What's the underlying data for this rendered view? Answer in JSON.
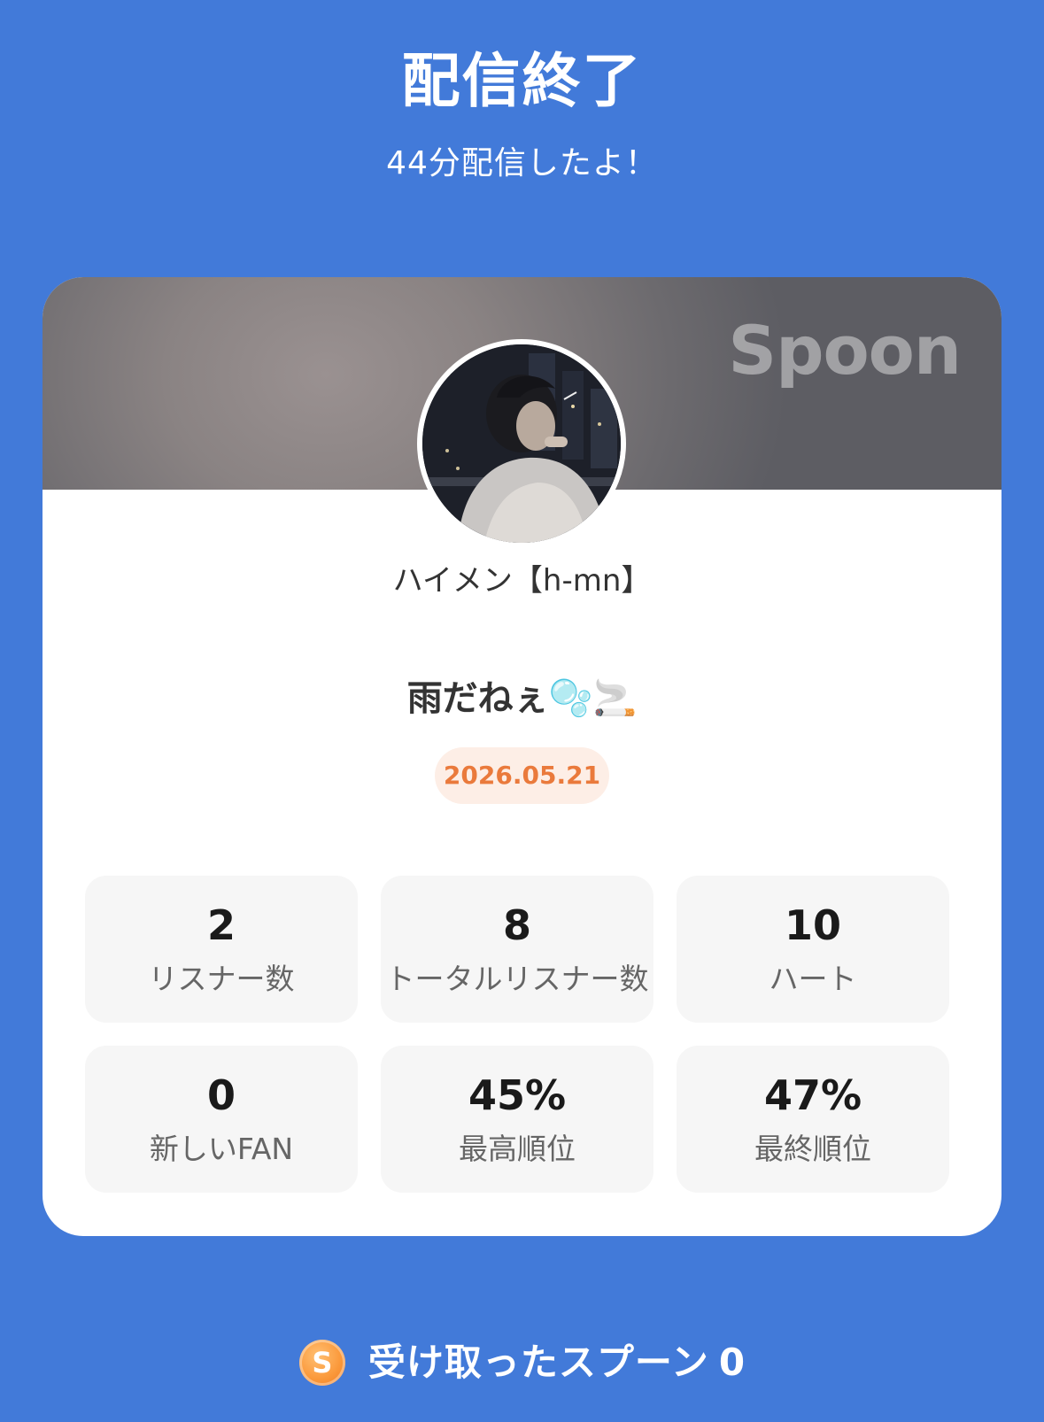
{
  "header": {
    "title": "配信終了",
    "subtitle": "44分配信したよ！"
  },
  "card": {
    "brand": "Spoon",
    "username": "ハイメン【h-mn】",
    "live_title": "雨だねぇ🫧🚬",
    "date": "2026.05.21"
  },
  "stats": [
    {
      "value": "2",
      "label": "リスナー数"
    },
    {
      "value": "8",
      "label": "トータルリスナー数"
    },
    {
      "value": "10",
      "label": "ハート"
    },
    {
      "value": "0",
      "label": "新しいFAN"
    },
    {
      "value": "45%",
      "label": "最高順位"
    },
    {
      "value": "47%",
      "label": "最終順位"
    }
  ],
  "spoons": {
    "coin_letter": "S",
    "label": "受け取ったスプーン",
    "count": "0"
  },
  "colors": {
    "background": "#427ad9",
    "date_text": "#ea7a3c",
    "date_bg": "#fdeee6",
    "coin": "#fb9a3c"
  },
  "icons": {
    "avatar": "profile-photo",
    "coin": "spoon-coin-icon"
  }
}
